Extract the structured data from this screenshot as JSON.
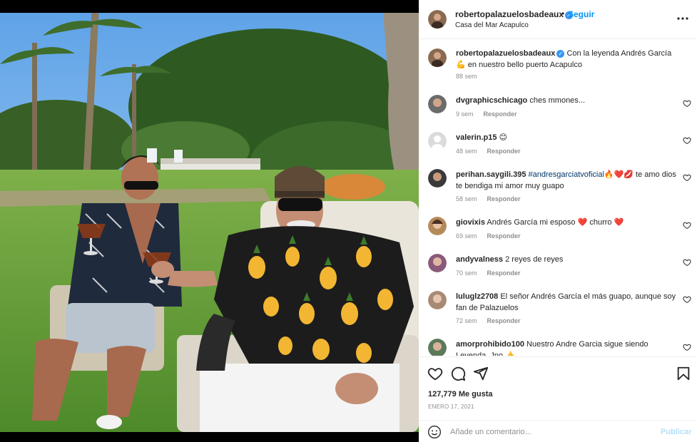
{
  "header": {
    "username": "robertopalazuelosbadeaux",
    "verified_glyph": "✓",
    "separator": "•",
    "follow_label": "Seguir",
    "location": "Casa del Mar Acapulco",
    "more_icon": "more-horizontal-icon"
  },
  "caption": {
    "username": "robertopalazuelosbadeaux",
    "text": "Con la leyenda Andrés García 💪 en nuestro bello puerto Acapulco",
    "time": "88 sem"
  },
  "comments": [
    {
      "username": "dvgraphicschicago",
      "text": "ches mmones...",
      "time": "9 sem",
      "reply": "Responder"
    },
    {
      "username": "valerin.p15",
      "text": "😊",
      "time": "48 sem",
      "reply": "Responder"
    },
    {
      "username": "perihan.saygili.395",
      "hashtag": "#andresgarciatvoficial",
      "text": "🔥❤️💋 te amo dios te bendiga mi amor muy guapo",
      "time": "58 sem",
      "reply": "Responder"
    },
    {
      "username": "giovixis",
      "text": "Andrés García mi esposo ❤️ churro ❤️",
      "time": "69 sem",
      "reply": "Responder"
    },
    {
      "username": "andyvalness",
      "text": "2 reyes de reyes",
      "time": "70 sem",
      "reply": "Responder"
    },
    {
      "username": "luluglz2708",
      "text": "El señor Andrés García el más guapo, aunque soy fan de Palazuelos",
      "time": "72 sem",
      "reply": "Responder"
    },
    {
      "username": "amorprohibido100",
      "text": "Nuestro Andre Garcia sigue siendo Leyenda. Jno 👍",
      "time": "",
      "reply": ""
    }
  ],
  "actions": {
    "like_icon": "heart-icon",
    "comment_icon": "comment-icon",
    "share_icon": "share-icon",
    "save_icon": "bookmark-icon",
    "likes": "127,779 Me gusta",
    "date": "ENERO 17, 2021"
  },
  "add_comment": {
    "placeholder": "Añade un comentario...",
    "publish": "Publicar",
    "emoji_icon": "emoji-icon"
  },
  "colors": {
    "link_blue": "#0095f6",
    "verified_blue": "#3897f0",
    "hashtag": "#00376b",
    "muted": "#8e8e8e",
    "publish_disabled": "#b3dffc"
  }
}
